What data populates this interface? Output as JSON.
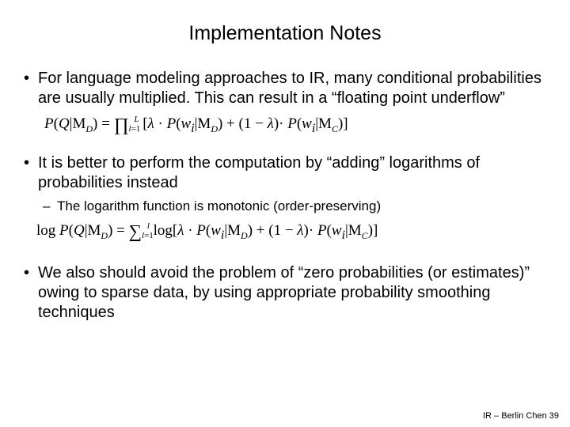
{
  "title": "Implementation Notes",
  "bullets": {
    "b1": "For language modeling approaches to IR, many conditional probabilities are usually multiplied. This can result in a “floating point underflow”",
    "b2": "It is better to perform the computation by “adding” logarithms of probabilities instead",
    "b2_sub": "The logarithm function is monotonic (order-preserving)",
    "b3": "We also should avoid the problem of “zero probabilities (or estimates)” owing to sparse data, by using appropriate probability smoothing techniques"
  },
  "equations": {
    "eq1": "P(Q|M_D) = ∏_{l=1}^{L} [ λ · P(w_i | M_D) + (1 − λ) · P(w_i | M_C) ]",
    "eq2": "log P(Q|M_D) = ∑_{l=1}^{l} log[ λ · P(w_i | M_D) + (1 − λ) · P(w_i | M_C) ]"
  },
  "footer": "IR – Berlin Chen 39"
}
